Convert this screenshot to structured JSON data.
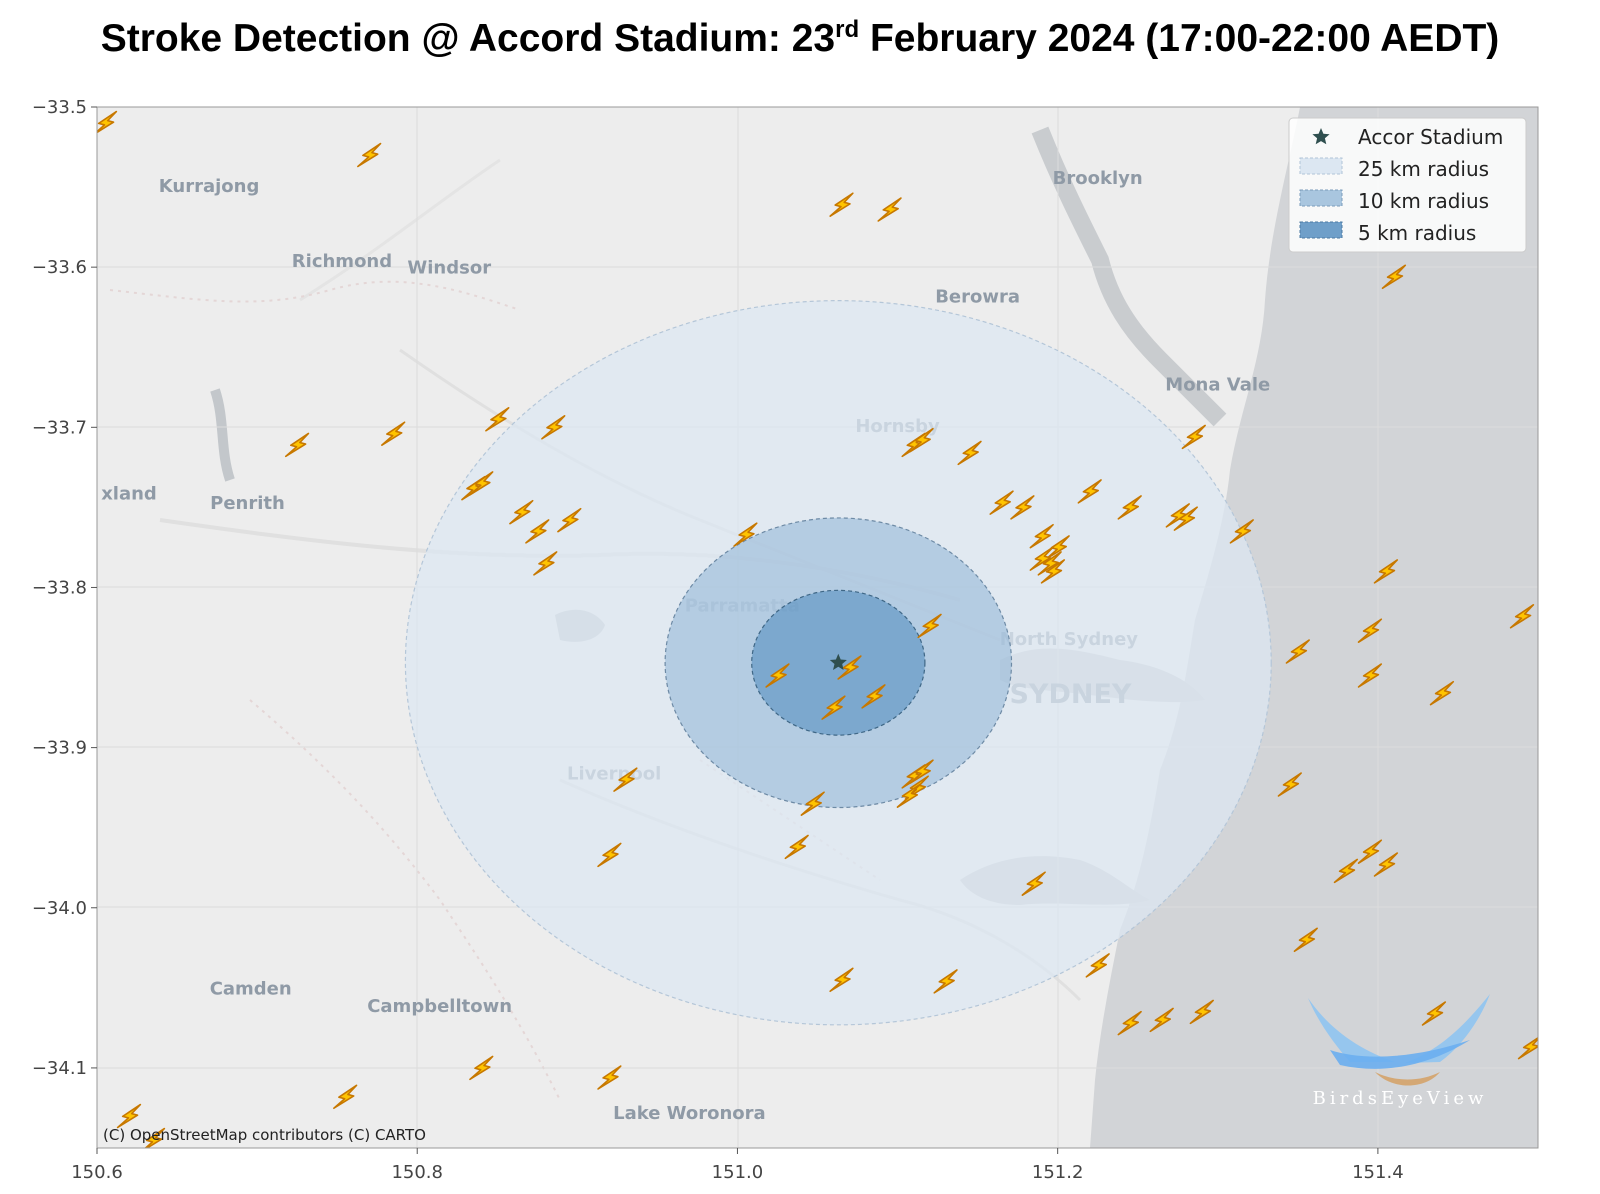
{
  "title": {
    "main": "Stroke Detection @ Accord Stadium: 23",
    "sup": "rd",
    "rest": " February 2024 (17:00-22:00 AEDT)"
  },
  "chart_data": {
    "type": "scatter",
    "xlim": [
      150.6,
      151.5
    ],
    "ylim": [
      -34.15,
      -33.5
    ],
    "x_ticks": [
      "150.6",
      "150.8",
      "151.0",
      "151.2",
      "151.4"
    ],
    "y_ticks": [
      "−33.5",
      "−33.6",
      "−33.7",
      "−33.8",
      "−33.9",
      "−34.0",
      "−34.1"
    ],
    "stadium": {
      "name": "Accor Stadium",
      "lon": 151.063,
      "lat": -33.847
    },
    "radii_km": [
      25,
      10,
      5
    ],
    "legend": [
      {
        "label": "Accor Stadium",
        "marker": "star",
        "color": "#2f4f4f"
      },
      {
        "label": "25 km radius",
        "marker": "patch",
        "color": "#dce7f2"
      },
      {
        "label": "10 km radius",
        "marker": "patch",
        "color": "#a9c6df"
      },
      {
        "label": "5 km radius",
        "marker": "patch",
        "color": "#6f9fc9"
      }
    ],
    "legend_position": "top-right",
    "strokes": [
      [
        150.605,
        -33.51
      ],
      [
        150.77,
        -33.53
      ],
      [
        150.725,
        -33.711
      ],
      [
        150.785,
        -33.704
      ],
      [
        150.85,
        -33.695
      ],
      [
        150.885,
        -33.7
      ],
      [
        150.835,
        -33.738
      ],
      [
        150.84,
        -33.735
      ],
      [
        150.865,
        -33.753
      ],
      [
        150.875,
        -33.765
      ],
      [
        150.895,
        -33.758
      ],
      [
        150.88,
        -33.785
      ],
      [
        151.005,
        -33.767
      ],
      [
        150.93,
        -33.92
      ],
      [
        150.92,
        -33.967
      ],
      [
        151.065,
        -33.561
      ],
      [
        151.095,
        -33.564
      ],
      [
        151.11,
        -33.711
      ],
      [
        151.115,
        -33.708
      ],
      [
        151.145,
        -33.716
      ],
      [
        151.165,
        -33.747
      ],
      [
        151.178,
        -33.75
      ],
      [
        151.19,
        -33.768
      ],
      [
        151.195,
        -33.785
      ],
      [
        151.197,
        -33.79
      ],
      [
        151.2,
        -33.775
      ],
      [
        151.19,
        -33.782
      ],
      [
        151.22,
        -33.74
      ],
      [
        151.245,
        -33.75
      ],
      [
        151.275,
        -33.755
      ],
      [
        151.28,
        -33.757
      ],
      [
        151.285,
        -33.706
      ],
      [
        151.315,
        -33.765
      ],
      [
        151.41,
        -33.606
      ],
      [
        151.405,
        -33.79
      ],
      [
        151.395,
        -33.827
      ],
      [
        151.395,
        -33.855
      ],
      [
        151.35,
        -33.84
      ],
      [
        151.44,
        -33.866
      ],
      [
        151.49,
        -33.818
      ],
      [
        151.025,
        -33.855
      ],
      [
        151.07,
        -33.85
      ],
      [
        151.085,
        -33.868
      ],
      [
        151.06,
        -33.875
      ],
      [
        151.12,
        -33.824
      ],
      [
        151.047,
        -33.935
      ],
      [
        151.037,
        -33.962
      ],
      [
        151.11,
        -33.918
      ],
      [
        151.115,
        -33.915
      ],
      [
        151.112,
        -33.925
      ],
      [
        151.107,
        -33.93
      ],
      [
        151.065,
        -34.045
      ],
      [
        151.13,
        -34.046
      ],
      [
        151.185,
        -33.985
      ],
      [
        151.225,
        -34.036
      ],
      [
        151.245,
        -34.072
      ],
      [
        151.265,
        -34.07
      ],
      [
        151.29,
        -34.065
      ],
      [
        151.345,
        -33.923
      ],
      [
        151.355,
        -34.02
      ],
      [
        151.38,
        -33.977
      ],
      [
        151.395,
        -33.965
      ],
      [
        151.405,
        -33.973
      ],
      [
        151.435,
        -34.066
      ],
      [
        151.495,
        -34.087
      ],
      [
        150.755,
        -34.118
      ],
      [
        150.84,
        -34.1
      ],
      [
        150.92,
        -34.106
      ],
      [
        150.62,
        -34.13
      ],
      [
        150.635,
        -34.145
      ]
    ]
  },
  "map": {
    "places": [
      {
        "name": "Kurrajong",
        "lon": 150.67,
        "lat": -33.553
      },
      {
        "name": "Richmond",
        "lon": 150.753,
        "lat": -33.6
      },
      {
        "name": "Windsor",
        "lon": 150.82,
        "lat": -33.604
      },
      {
        "name": "Brooklyn",
        "lon": 151.225,
        "lat": -33.548
      },
      {
        "name": "Berowra",
        "lon": 151.15,
        "lat": -33.622
      },
      {
        "name": "Mona Vale",
        "lon": 151.3,
        "lat": -33.677
      },
      {
        "name": "Hornsby",
        "lon": 151.1,
        "lat": -33.703
      },
      {
        "name": "xland",
        "lon": 150.62,
        "lat": -33.745
      },
      {
        "name": "Penrith",
        "lon": 150.694,
        "lat": -33.751
      },
      {
        "name": "Parramatta",
        "lon": 151.003,
        "lat": -33.815
      },
      {
        "name": "North Sydney",
        "lon": 151.207,
        "lat": -33.836
      },
      {
        "name": "SYDNEY",
        "lon": 151.208,
        "lat": -33.872
      },
      {
        "name": "Liverpool",
        "lon": 150.923,
        "lat": -33.92
      },
      {
        "name": "Camden",
        "lon": 150.696,
        "lat": -34.054
      },
      {
        "name": "Campbelltown",
        "lon": 150.814,
        "lat": -34.065
      },
      {
        "name": "Lake Woronora",
        "lon": 150.97,
        "lat": -34.132
      }
    ],
    "attribution": "(C) OpenStreetMap contributors (C) CARTO",
    "logo_text": "BirdsEyeView"
  }
}
